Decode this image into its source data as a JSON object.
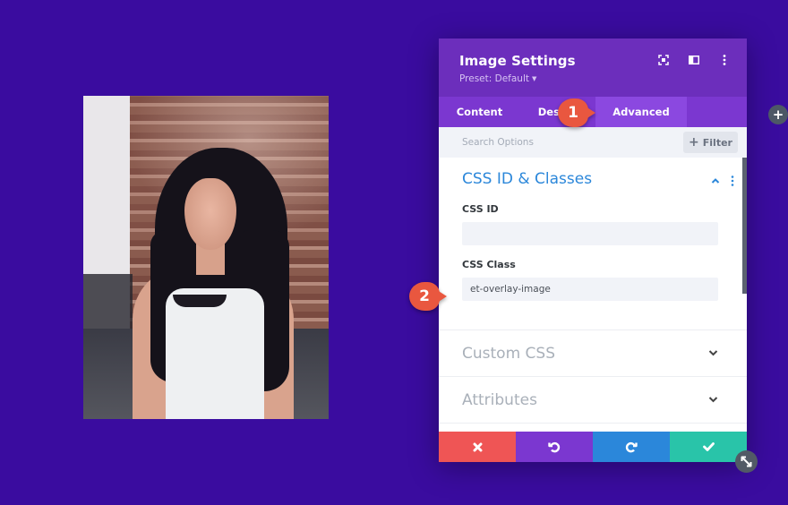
{
  "photo": {
    "alt": "woman with long dark hair wearing white tank top"
  },
  "panel": {
    "title": "Image Settings",
    "preset_label": "Preset: Default",
    "header_icons": [
      "focus-icon",
      "split-view-icon",
      "more-options-icon"
    ],
    "tabs": [
      {
        "label": "Content",
        "active": false
      },
      {
        "label": "Design",
        "active": false
      },
      {
        "label": "Advanced",
        "active": true
      }
    ],
    "search": {
      "placeholder": "Search Options",
      "value": ""
    },
    "filter_label": "Filter",
    "sections": {
      "css_id_classes": {
        "title": "CSS ID & Classes",
        "expanded": true,
        "fields": [
          {
            "label": "CSS ID",
            "value": ""
          },
          {
            "label": "CSS Class",
            "value": "et-overlay-image"
          }
        ]
      },
      "custom_css": {
        "title": "Custom CSS",
        "expanded": false
      },
      "attributes": {
        "title": "Attributes",
        "expanded": false
      }
    },
    "footer": {
      "buttons": [
        {
          "name": "cancel",
          "icon": "close-icon",
          "color": "#ef5555"
        },
        {
          "name": "undo",
          "icon": "undo-icon",
          "color": "#7b37d0"
        },
        {
          "name": "redo",
          "icon": "redo-icon",
          "color": "#2b87da"
        },
        {
          "name": "save",
          "icon": "check-icon",
          "color": "#29c4a9"
        }
      ]
    }
  },
  "callouts": [
    {
      "number": "1"
    },
    {
      "number": "2"
    }
  ],
  "colors": {
    "background": "#3a0c9f",
    "header": "#6c2ebc",
    "tabs": "#7b37d0",
    "active_tab": "#8b48e0",
    "accent_blue": "#2b87da",
    "callout": "#e9573f"
  }
}
